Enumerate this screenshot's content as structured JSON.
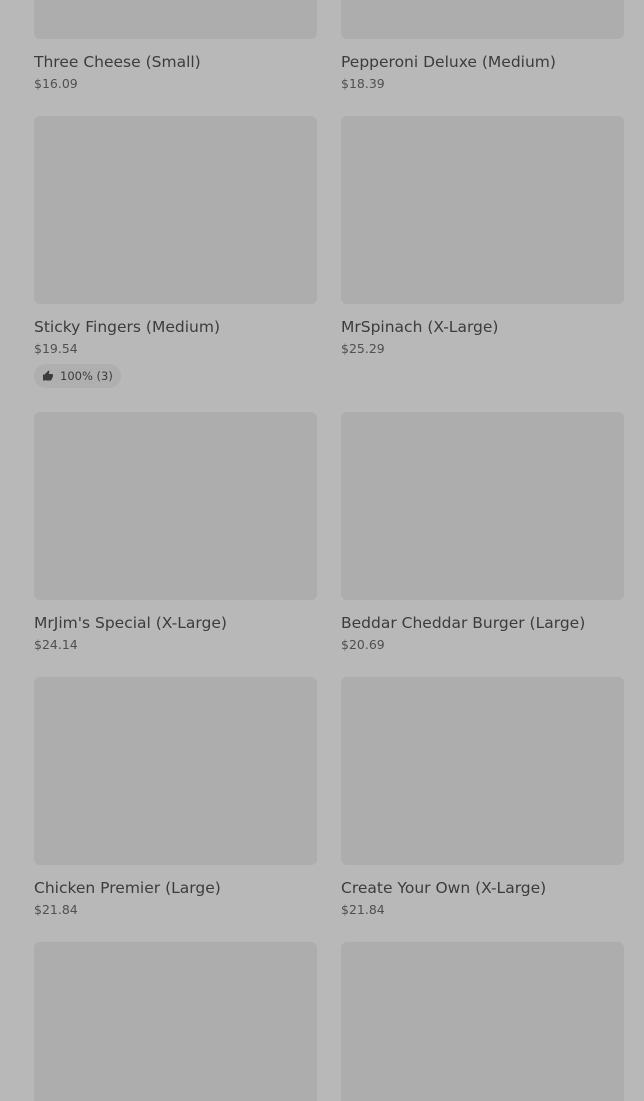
{
  "items": [
    {
      "name": "Three Cheese (Small)",
      "price": "$16.09"
    },
    {
      "name": "Pepperoni Deluxe (Medium)",
      "price": "$18.39"
    },
    {
      "name": "Sticky Fingers (Medium)",
      "price": "$19.54",
      "rating": "100% (3)"
    },
    {
      "name": "MrSpinach (X-Large)",
      "price": "$25.29"
    },
    {
      "name": "MrJim's Special (X-Large)",
      "price": "$24.14"
    },
    {
      "name": "Beddar Cheddar Burger (Large)",
      "price": "$20.69"
    },
    {
      "name": "Chicken Premier (Large)",
      "price": "$21.84"
    },
    {
      "name": "Create Your Own (X-Large)",
      "price": "$21.84"
    },
    {
      "name": "",
      "price": ""
    },
    {
      "name": "",
      "price": ""
    }
  ],
  "icons": {
    "rating": "thumbs-up-icon"
  }
}
